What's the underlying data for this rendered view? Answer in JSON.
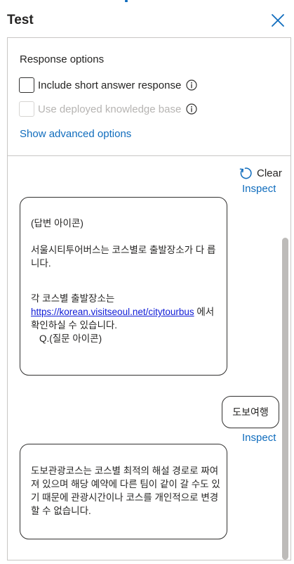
{
  "header": {
    "title": "Test",
    "close_icon": "close-icon"
  },
  "response_options": {
    "title": "Response options",
    "include_short_answer": {
      "label": "Include short answer response",
      "checked": false,
      "enabled": true
    },
    "use_deployed_kb": {
      "label": "Use deployed knowledge base",
      "checked": false,
      "enabled": false
    },
    "advanced_link": "Show advanced options"
  },
  "chat": {
    "clear_label": "Clear",
    "inspect_label": "Inspect",
    "messages": [
      {
        "role": "bot",
        "line1": "(답변 아이콘)",
        "line2": "서울시티투어버스는 코스별로 출발장소가 다 릅니다.",
        "line3_prefix": "각 코스별 출발장소는",
        "link": "https://korean.visitseoul.net/citytourbus",
        "line3_suffix": " 에서 확인하실 수 있습니다.",
        "line4": "Q.(질문 아이콘)"
      },
      {
        "role": "user",
        "text": "도보여행"
      },
      {
        "role": "bot",
        "text": "도보관광코스는 코스별 최적의 해설 경로로 짜여져 있으며 해당 예약에 다른 팀이 같이 갈 수도 있기 때문에 관광시간이나 코스를 개인적으로 변경할 수 없습니다."
      }
    ]
  },
  "colors": {
    "accent": "#0f6cbd",
    "link": "#0f1bd6",
    "border": "#c8c6c4",
    "text": "#252423"
  }
}
